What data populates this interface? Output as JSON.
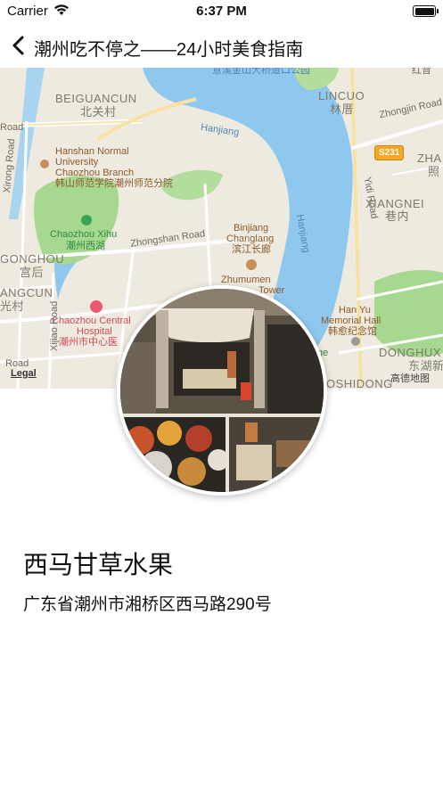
{
  "status_bar": {
    "carrier": "Carrier",
    "time": "6:37 PM"
  },
  "nav": {
    "title": "潮州吃不停之——24小时美食指南",
    "back_icon": "chevron-left-icon"
  },
  "map": {
    "labels": {
      "top_bridge": "意溪金山大桥道口公园",
      "top_right": "红音",
      "beiguancun_en": "BEIGUANCUN",
      "beiguancun_zh": "北关村",
      "lincuo_en": "LINCUO",
      "lincuo_zh": "林厝",
      "zhongjin": "Zhongjin Road",
      "road_left": "Road",
      "hanjiang": "Hanjiang",
      "hanjiang_v": "Hanjiang",
      "hanshan_en_1": "Hanshan Normal",
      "hanshan_en_2": "University",
      "hanshan_en_3": "Chaozhou Branch",
      "hanshan_zh": "韩山师范学院潮州师范分院",
      "xirong": "Xirong Road",
      "zha": "ZHA",
      "zhao": "照",
      "yidi": "Yidi Road",
      "xiangnei_en": "XIANGNEI",
      "xiangnei_zh": "巷内",
      "xihu_en": "Chaozhou Xihu",
      "xihu_zh": "潮州西湖",
      "zhongshan": "Zhongshan Road",
      "binjiang_en_1": "Binjiang",
      "binjiang_en_2": "Changlang",
      "binjiang_zh": "滨江长廊",
      "gonghou_en": "GONGHOU",
      "gonghou_zh": "宫后",
      "zhumumen_en": "Zhumumen",
      "zhumumen_en2": "Tower",
      "angcun_en": "ANGCUN",
      "angcun_zh": "光村",
      "hospital_en_1": "Chaozhou Central",
      "hospital_en_2": "Hospital",
      "hospital_zh": "潮州市中心医",
      "hanyu_en_1": "Han Yu",
      "hanyu_en_2": "Memorial Hall",
      "hanyu_zh": "韩愈纪念馆",
      "donghu_en": "DONGHUX",
      "donghu_zh": "东湖新",
      "legal": "Legal",
      "road_bottom": "Road",
      "xijiao": "Xijiao Road",
      "oshidong": "OSHIDONG",
      "attribution": "高德地图",
      "road_badge": "S231",
      "ge": "ge"
    }
  },
  "place": {
    "name": "西马甘草水果",
    "address": "广东省潮州市湘桥区西马路290号"
  },
  "colors": {
    "land": "#efeadf",
    "water": "#8fc8ee",
    "park": "#9fd68a",
    "road": "#ffffff",
    "badge": "#f5a623"
  }
}
